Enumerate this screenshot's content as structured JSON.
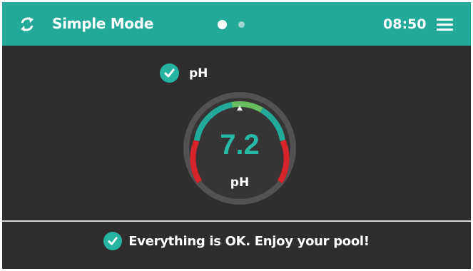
{
  "header": {
    "mode_label": "Simple Mode",
    "time": "08:50",
    "page_count": 2,
    "active_page": 1,
    "refresh_icon": "refresh-icon",
    "menu_icon": "hamburger-menu-icon"
  },
  "sensor": {
    "checked": true,
    "label": "pH"
  },
  "gauge": {
    "value": "7.2",
    "unit": "pH",
    "colors": {
      "ok": "#22a99a",
      "ideal": "#67bd60",
      "alarm": "#d7232a"
    }
  },
  "status": {
    "message": "Everything is OK. Enjoy your pool!",
    "icon": "check-circle-icon"
  },
  "colors": {
    "header_bg": "#22a99a",
    "screen_bg": "#2f2d2e",
    "accent": "#29b9a7"
  }
}
